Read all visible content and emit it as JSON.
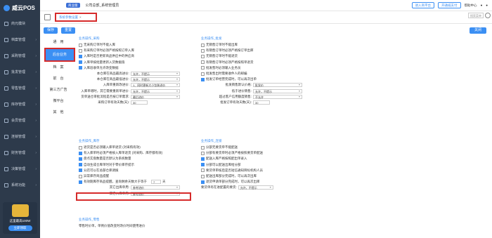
{
  "app": {
    "logo": "威云POS"
  },
  "sidebar": {
    "items": [
      {
        "label": "商元模块"
      },
      {
        "label": "档案管理"
      },
      {
        "label": "采购管理"
      },
      {
        "label": "批发管理"
      },
      {
        "label": "零售管理"
      },
      {
        "label": "库存管理"
      },
      {
        "label": "会员管理"
      },
      {
        "label": "连锁管理"
      },
      {
        "label": "财务管理"
      },
      {
        "label": "决策管理"
      },
      {
        "label": "系统功能"
      }
    ],
    "promo": {
      "text": "这里最高100W",
      "button": "立即领取"
    }
  },
  "topbar": {
    "vip": "商业版",
    "company": "公司总部_系统管理员",
    "btn1": "进入商平台",
    "btn2": "开通威支付",
    "help": "帮助中心"
  },
  "tabbar": {
    "active_tab": "系统参数设置",
    "close": "×",
    "search_placeholder": "搜索菜单"
  },
  "toolbar": {
    "save": "保存",
    "reset": "重置",
    "close": "关闭"
  },
  "leftmenu": {
    "items": [
      "通　用",
      "后台业务",
      "档　案",
      "前　台",
      "第三方广告",
      "微平台",
      "其　他"
    ],
    "active": "后台业务"
  },
  "purchase": {
    "title": "业务操作_采购",
    "rows": [
      {
        "label": "无采购订单时不能入库",
        "checked": false
      },
      {
        "label": "有采购订单时必须严格按照订单入库",
        "checked": false
      },
      {
        "label": "入库时是否更新商品供应中的供应商",
        "checked": true
      },
      {
        "label": "入库单按批量更新入货数据值",
        "checked": true
      },
      {
        "label": "入库验收单允许改变数据",
        "checked": true
      }
    ],
    "fields": [
      {
        "label": "本仓库在商品最高进价:",
        "value": "允许，不提示"
      },
      {
        "label": "本仓库在商品最低进价:",
        "value": "允许，不提示"
      },
      {
        "label": "入库单重新改进价:",
        "value": "1、同时更新大小包装进价"
      },
      {
        "label": "入库单增时，其它需要重新单进价:",
        "value": "允许，不提示"
      },
      {
        "label": "货单送仓审批流程是否按订单需求:",
        "value": "最后进价"
      }
    ],
    "days_label": "采购订单有效天数(天):",
    "days_value": "30"
  },
  "wholesale": {
    "title": "业务操作_批发",
    "rows": [
      {
        "label": "无销售订单时不能出库",
        "checked": false
      },
      {
        "label": "有销售订单时必须严格按订单出库",
        "checked": false
      },
      {
        "label": "无销售订单时不能退货",
        "checked": false
      },
      {
        "label": "有销售订单时必须严格按照单退货",
        "checked": false
      },
      {
        "label": "批发售时必须输入业务员",
        "checked": false
      },
      {
        "label": "批发售出时需要收件人的邮编",
        "checked": false
      },
      {
        "label": "批发订单经营完成时，可以再次出单",
        "checked": true
      }
    ],
    "fields": [
      {
        "label": "批发销售默认价格:",
        "value": "批发价"
      },
      {
        "label": "低于进价销售:",
        "value": "允许，不提示"
      },
      {
        "label": "超过客户信用额度销售:",
        "value": "不允许"
      }
    ],
    "days_label": "批发订单有效天数(天):",
    "days_value": "30"
  },
  "stock": {
    "title": "业务操作_库存",
    "rows": [
      {
        "label": "退货是否必须输入库单退货 (对采购有效)",
        "checked": false
      },
      {
        "label": "有入库单时必须严格按入库单退货 (对采购、库存都有效)",
        "checked": true
      },
      {
        "label": "盘点实盘数量是否默认为系统数量",
        "checked": true
      },
      {
        "label": "自动生成仓库单时对于零价库存提示",
        "checked": true
      },
      {
        "label": "分店可以在总部仓库调拨",
        "checked": true
      },
      {
        "label": "异常库存商品提醒",
        "checked": false
      },
      {
        "label": "有效期库存商品提醒，查询剩余天数大于等于",
        "checked": true
      }
    ],
    "remain_value": "7",
    "remain_unit": "天",
    "fields": [
      {
        "label": "其它出库单用:",
        "value": "参考进价"
      },
      {
        "label": "其它入库单用:",
        "value": "参考进价"
      }
    ]
  },
  "chain": {
    "title": "业务操作_连锁",
    "rows": [
      {
        "label": "分部无要货单不能配送",
        "checked": false
      },
      {
        "label": "分部有要货单时必须严格按照要货单配送",
        "checked": false
      },
      {
        "label": "配送入库严格按照配出单录入",
        "checked": true
      },
      {
        "label": "分部可以配送出库给分部",
        "checked": true
      },
      {
        "label": "要货单审核后是否短信通知目标机构人员",
        "checked": false
      },
      {
        "label": "配送出库部分完成时，可以再次出库",
        "checked": false
      },
      {
        "label": "退货申请单部分完成时，可以再次出库",
        "checked": true
      }
    ],
    "field_label": "要货单有在进配置的要货:",
    "field_value": "允许，不提示"
  },
  "retail": {
    "title": "业务操作_零售",
    "row": "零售时价单，单例价值改变时改价时间使用进价"
  }
}
